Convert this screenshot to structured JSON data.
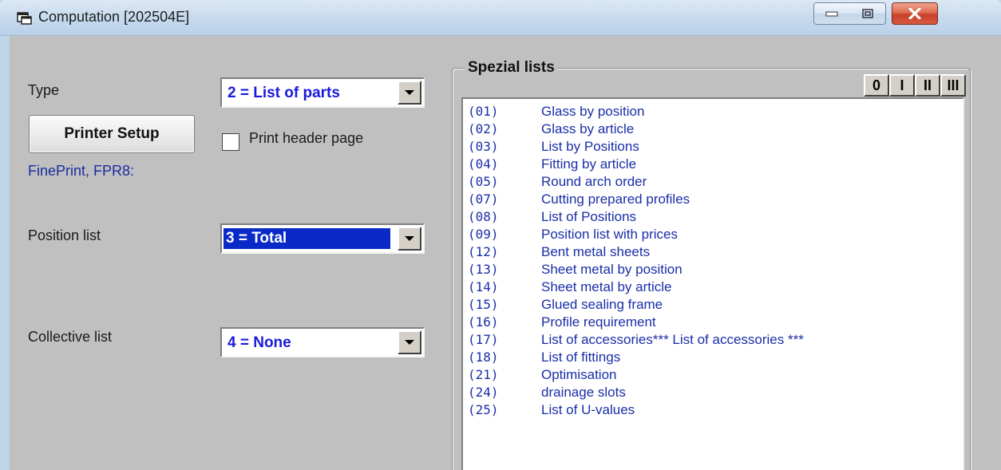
{
  "window": {
    "title": "Computation [202504E]",
    "icon": "app-window-icon",
    "controls": {
      "minimize": "minimize-icon",
      "maximize": "maximize-icon",
      "close": "close-icon"
    }
  },
  "form": {
    "type_label": "Type",
    "type_value": "2 = List of parts",
    "printer_setup_label": "Printer Setup",
    "print_header_label": "Print header page",
    "print_header_checked": false,
    "printer_name": "FinePrint, FPR8:",
    "position_list_label": "Position list",
    "position_list_value": "3 = Total",
    "collective_list_label": "Collective list",
    "collective_list_value": "4 = None"
  },
  "special_lists": {
    "title": "Spezial lists",
    "level_buttons": [
      "0",
      "I",
      "II",
      "III"
    ],
    "items": [
      {
        "code": "(01)",
        "name": "Glass by position"
      },
      {
        "code": "(02)",
        "name": "Glass by article"
      },
      {
        "code": "(03)",
        "name": "List by Positions"
      },
      {
        "code": "(04)",
        "name": "Fitting by article"
      },
      {
        "code": "(05)",
        "name": "Round arch order"
      },
      {
        "code": "(07)",
        "name": "Cutting prepared profiles"
      },
      {
        "code": "(08)",
        "name": "List of Positions"
      },
      {
        "code": "(09)",
        "name": "Position list with prices"
      },
      {
        "code": "(12)",
        "name": "Bent metal sheets"
      },
      {
        "code": "(13)",
        "name": "Sheet metal by position"
      },
      {
        "code": "(14)",
        "name": "Sheet metal by article"
      },
      {
        "code": "(15)",
        "name": "Glued sealing frame"
      },
      {
        "code": "(16)",
        "name": "Profile requirement"
      },
      {
        "code": "(17)",
        "name": "List of accessories*** List of accessories ***"
      },
      {
        "code": "(18)",
        "name": "List of fittings"
      },
      {
        "code": "(21)",
        "name": "Optimisation"
      },
      {
        "code": "(24)",
        "name": "drainage slots"
      },
      {
        "code": "(25)",
        "name": "List of U-values"
      }
    ]
  },
  "colors": {
    "list_text": "#1a2ea8",
    "selection": "#0a2ac8",
    "combo_text": "#1a1adc"
  }
}
